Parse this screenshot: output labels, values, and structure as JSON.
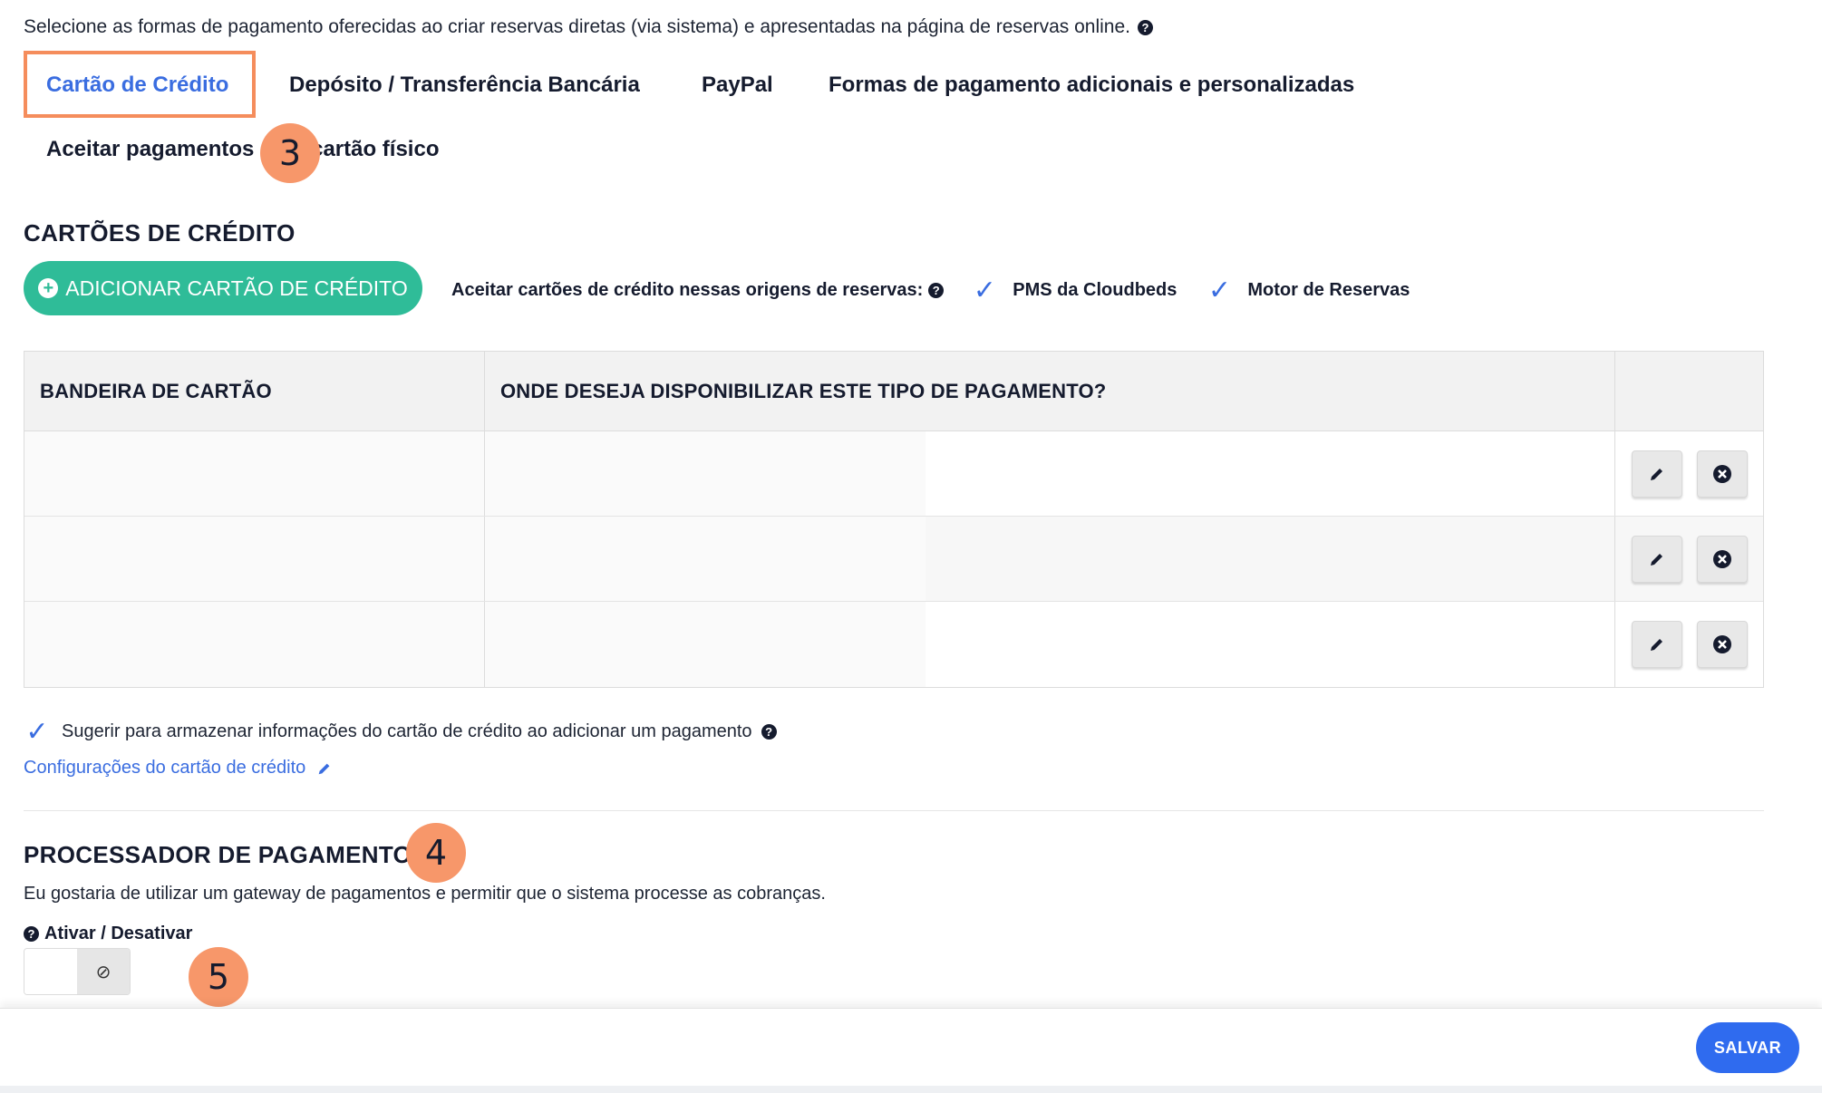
{
  "intro": {
    "text": "Selecione as formas de pagamento oferecidas ao criar reservas diretas (via sistema) e apresentadas na página de reservas online.",
    "help": "?"
  },
  "tabs": [
    {
      "label": "Cartão de Crédito",
      "active": true
    },
    {
      "label": "Depósito / Transferência Bancária",
      "active": false
    },
    {
      "label": "PayPal",
      "active": false
    },
    {
      "label": "Formas de pagamento adicionais e personalizadas",
      "active": false
    },
    {
      "label": "Aceitar pagamentos com cartão físico",
      "active": false
    }
  ],
  "badges": {
    "step3": "3",
    "step4": "4",
    "step5": "5"
  },
  "credit_cards": {
    "title": "CARTÕES DE CRÉDITO",
    "add_button": "ADICIONAR CARTÃO DE CRÉDITO",
    "accept_label": "Aceitar cartões de crédito nessas origens de reservas:",
    "origins": [
      {
        "label": "PMS da Cloudbeds",
        "checked": true
      },
      {
        "label": "Motor de Reservas",
        "checked": true
      }
    ]
  },
  "table": {
    "headers": [
      "BANDEIRA DE CARTÃO",
      "ONDE DESEJA DISPONIBILIZAR ESTE TIPO DE PAGAMENTO?",
      ""
    ],
    "row_count": 3
  },
  "suggest_store": {
    "checked": true,
    "label": "Sugerir para armazenar informações do cartão de crédito ao adicionar um pagamento"
  },
  "config_link": "Configurações do cartão de crédito",
  "processor": {
    "title": "PROCESSADOR DE PAGAMENTOS",
    "description": "Eu gostaria de utilizar um gateway de pagamentos e permitir que o sistema processe as cobranças.",
    "toggle_label": "Ativar / Desativar",
    "toggle_state": "off",
    "toggle_symbol": "⊘"
  },
  "footer": {
    "save": "SALVAR"
  },
  "colors": {
    "accent": "#3a6de0",
    "add_button": "#2fbc98",
    "highlight": "#f58d5c",
    "badge": "#f7976a",
    "save_button": "#2f6bef"
  }
}
